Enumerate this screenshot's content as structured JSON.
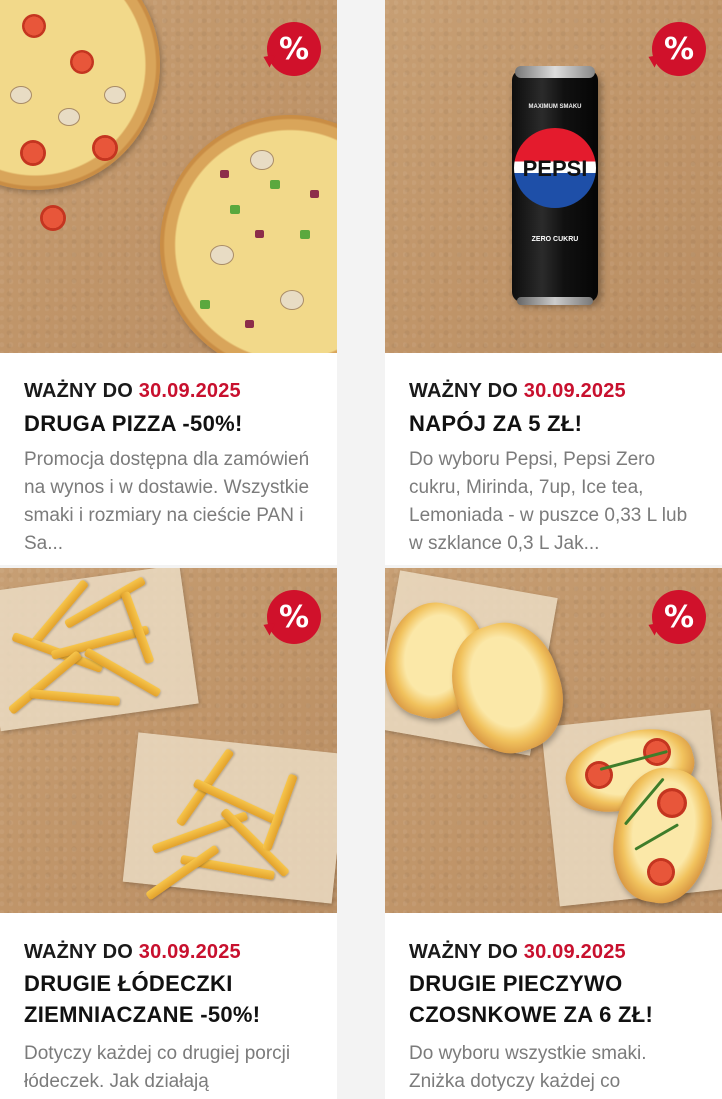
{
  "badge_symbol": "%",
  "accent_color": "#c8102e",
  "cards": [
    {
      "image_icon": "pizza-image",
      "valid_label": "WAŻNY DO",
      "valid_date": "30.09.2025",
      "title": "DRUGA PIZZA -50%!",
      "description": "Promocja dostępna dla zamówień na wynos i w dostawie. Wszystkie smaki i rozmiary na cieście PAN i Sa..."
    },
    {
      "image_icon": "pepsi-can-image",
      "image_text": {
        "top": "MAXIMUM SMAKU",
        "brand": "PEPSI",
        "bottom": "ZERO CUKRU"
      },
      "valid_label": "WAŻNY DO",
      "valid_date": "30.09.2025",
      "title": "NAPÓJ ZA 5 ZŁ!",
      "description": "Do wyboru Pepsi, Pepsi Zero cukru, Mirinda, 7up, Ice tea, Lemoniada - w puszce 0,33 L lub w szklance 0,3 L Jak..."
    },
    {
      "image_icon": "potato-wedges-image",
      "valid_label": "WAŻNY DO",
      "valid_date": "30.09.2025",
      "title_line1": "DRUGIE ŁÓDECZKI",
      "title_line2": "ZIEMNIACZANE -50%!",
      "description": "Dotyczy każdej co drugiej porcji łódeczek. Jak działają"
    },
    {
      "image_icon": "garlic-bread-image",
      "valid_label": "WAŻNY DO",
      "valid_date": "30.09.2025",
      "title_line1": "DRUGIE PIECZYWO",
      "title_line2": "CZOSNKOWE ZA 6 ZŁ!",
      "description": "Do wyboru wszystkie smaki. Zniżka dotyczy każdej co"
    }
  ]
}
